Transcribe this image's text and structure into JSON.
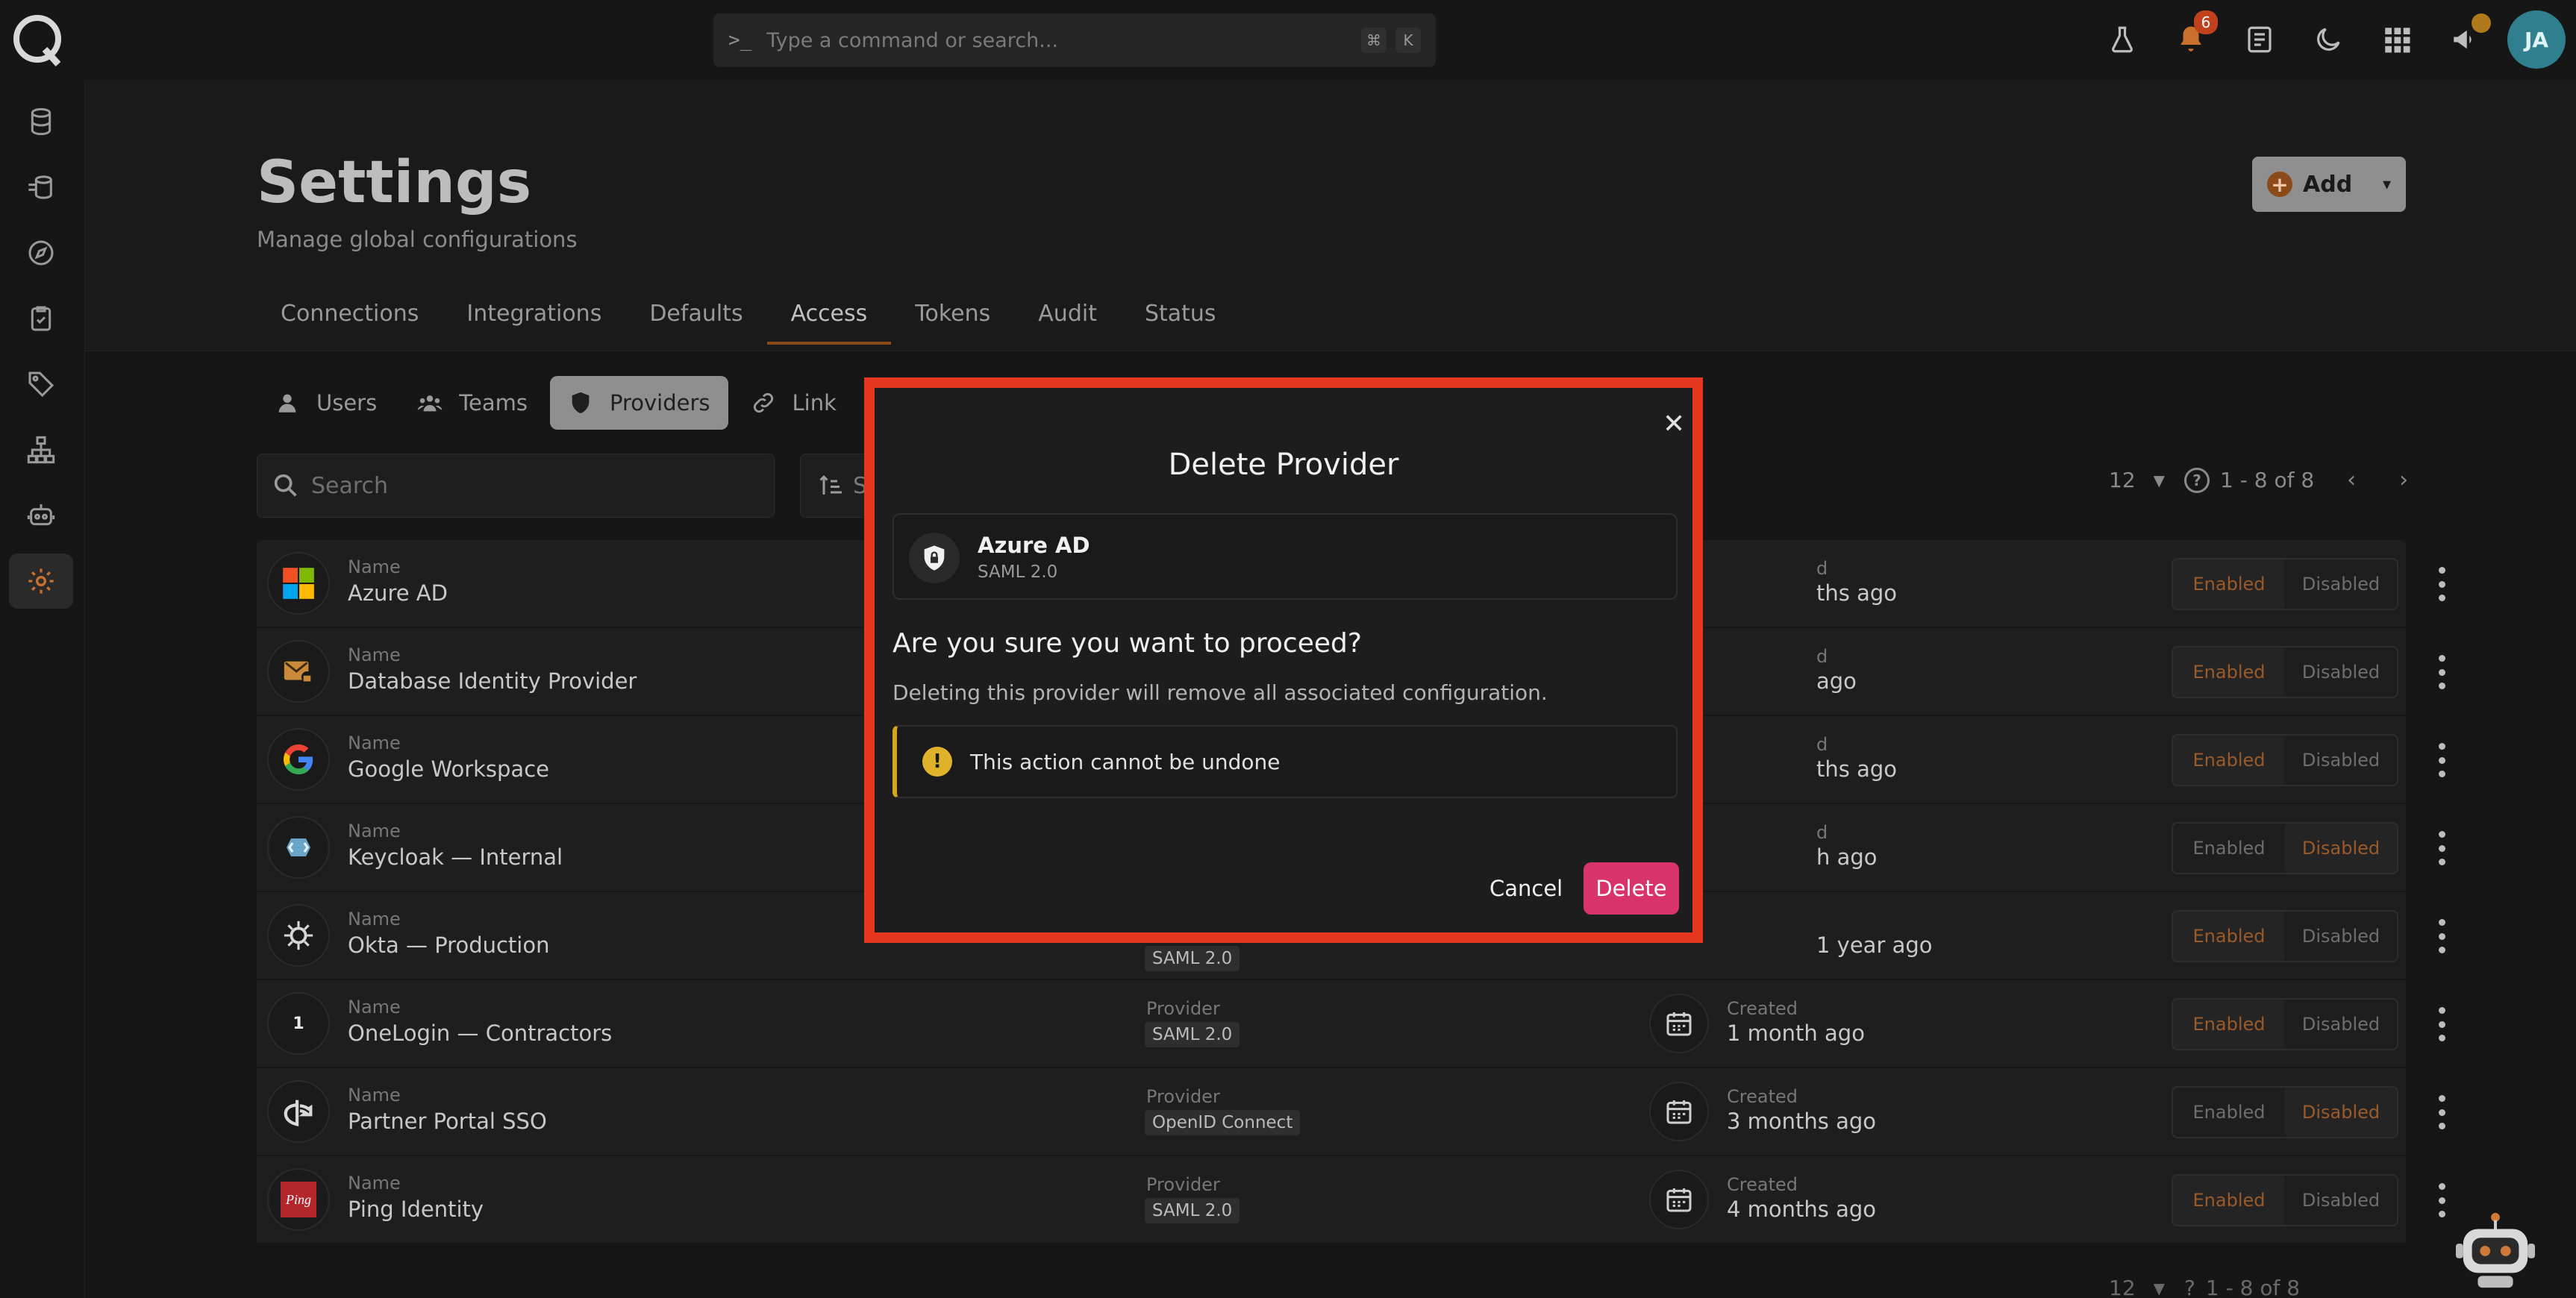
{
  "topbar": {
    "command_placeholder": "Type a command or search...",
    "shortcut_keys": [
      "⌘",
      "K"
    ],
    "notifications_count": "6",
    "avatar_initials": "JA",
    "icons": [
      "flask-icon",
      "bell-icon",
      "docs-icon",
      "moon-icon",
      "apps-grid-icon",
      "megaphone-icon"
    ]
  },
  "sidebar": {
    "items": [
      "database-icon",
      "data-flow-icon",
      "compass-icon",
      "checklist-icon",
      "tag-icon",
      "hierarchy-icon",
      "robot-icon",
      "gear-icon"
    ],
    "active": "gear-icon"
  },
  "page": {
    "title": "Settings",
    "subtitle": "Manage global configurations",
    "add_label": "Add"
  },
  "tabs": [
    "Connections",
    "Integrations",
    "Defaults",
    "Access",
    "Tokens",
    "Audit",
    "Status"
  ],
  "active_tab": "Access",
  "subtabs": [
    "Users",
    "Teams",
    "Providers",
    "Link"
  ],
  "active_subtab": "Providers",
  "search": {
    "placeholder": "Search"
  },
  "sort_label": "S",
  "pager": {
    "per_page": "12",
    "range": "1 - 8 of 8"
  },
  "pager_bottom": {
    "per_page": "12",
    "range": "1 - 8 of 8"
  },
  "table": {
    "name_label": "Name",
    "provider_label": "Provider",
    "created_label": "Created",
    "toggle_enabled": "Enabled",
    "toggle_disabled": "Disabled",
    "rows": [
      {
        "name": "Azure AD",
        "provider": "",
        "created": "ths ago",
        "state": "enabled",
        "icon": "microsoft-logo-icon"
      },
      {
        "name": "Database Identity Provider",
        "provider": "",
        "created": "ago",
        "state": "enabled",
        "icon": "database-id-icon"
      },
      {
        "name": "Google Workspace",
        "provider": "",
        "created": "ths ago",
        "state": "enabled",
        "icon": "google-logo-icon"
      },
      {
        "name": "Keycloak — Internal",
        "provider": "",
        "created": "h ago",
        "state": "disabled",
        "icon": "keycloak-logo-icon"
      },
      {
        "name": "Okta — Production",
        "provider": "SAML 2.0",
        "created": "1 year ago",
        "state": "enabled",
        "icon": "okta-logo-icon"
      },
      {
        "name": "OneLogin — Contractors",
        "provider": "SAML 2.0",
        "created": "1 month ago",
        "state": "enabled",
        "icon": "onelogin-logo-icon"
      },
      {
        "name": "Partner Portal SSO",
        "provider": "OpenID Connect",
        "created": "3 months ago",
        "state": "disabled",
        "icon": "openid-logo-icon"
      },
      {
        "name": "Ping Identity",
        "provider": "SAML 2.0",
        "created": "4 months ago",
        "state": "enabled",
        "icon": "ping-logo-icon"
      }
    ]
  },
  "modal": {
    "title": "Delete Provider",
    "provider_name": "Azure AD",
    "provider_type": "SAML 2.0",
    "question": "Are you sure you want to proceed?",
    "description": "Deleting this provider will remove all associated configuration.",
    "warning": "This action cannot be undone",
    "cancel_label": "Cancel",
    "delete_label": "Delete"
  },
  "colors": {
    "accent": "#8a4a1a",
    "modal_highlight_border": "#e5361f",
    "delete_button": "#d9336b",
    "warning": "#e0b12a",
    "avatar": "#2f7f8f"
  }
}
